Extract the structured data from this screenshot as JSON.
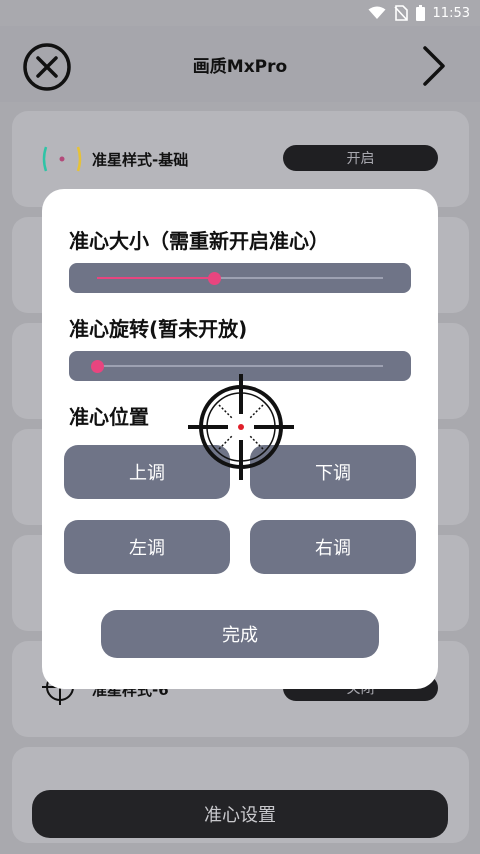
{
  "status_bar": {
    "time": "11:53"
  },
  "header": {
    "title": "画质MxPro"
  },
  "list": {
    "items": [
      {
        "label": "准星样式-基础",
        "toggle": "开启"
      },
      {
        "label": "准星样式-6",
        "toggle": "关闭"
      }
    ]
  },
  "dialog": {
    "size_title": "准心大小（需重新开启准心）",
    "size_value": 0.41,
    "rotation_title": "准心旋转(暂未开放)",
    "rotation_value": 0.0,
    "position_title": "准心位置",
    "buttons": {
      "up": "上调",
      "down": "下调",
      "left": "左调",
      "right": "右调"
    },
    "done": "完成"
  },
  "bottom": {
    "label": "准心设置"
  },
  "colors": {
    "accent": "#e8457f",
    "button": "#6f7487",
    "dark": "#232326"
  },
  "icons": [
    "wifi-icon",
    "no-sim-icon",
    "battery-icon",
    "close-circle-icon",
    "chevron-right-icon",
    "crosshair-icon",
    "scope-icon"
  ]
}
